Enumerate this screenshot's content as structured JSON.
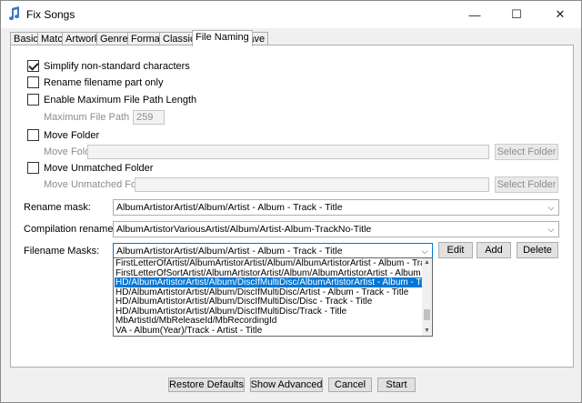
{
  "window": {
    "title": "Fix Songs",
    "minimize_glyph": "—",
    "maximize_glyph": "☐",
    "close_glyph": "✕"
  },
  "tabs": [
    {
      "label": "Basic"
    },
    {
      "label": "Match"
    },
    {
      "label": "Artwork"
    },
    {
      "label": "Genres"
    },
    {
      "label": "Format"
    },
    {
      "label": "Classical"
    },
    {
      "label": "File Naming",
      "active": true
    },
    {
      "label": "Save"
    }
  ],
  "options": {
    "simplify": {
      "label": "Simplify non-standard characters",
      "checked": true
    },
    "rename_part": {
      "label": "Rename filename part only",
      "checked": false
    },
    "max_path": {
      "label": "Enable Maximum File Path Length",
      "checked": false
    },
    "max_path_length_label": "Maximum File Path Length",
    "max_path_length_value": "259",
    "move_folder": {
      "label": "Move Folder",
      "checked": false
    },
    "move_folder_field_label": "Move Folder",
    "move_folder_value": "",
    "select_folder_1": "Select Folder",
    "move_unmatched": {
      "label": "Move Unmatched Folder",
      "checked": false
    },
    "move_unmatched_field_label": "Move Unmatched Folder",
    "move_unmatched_value": "",
    "select_folder_2": "Select Folder"
  },
  "masks": {
    "rename_label": "Rename mask:",
    "rename_value": "AlbumArtistorArtist/Album/Artist - Album - Track - Title",
    "compilation_label": "Compilation rename mask:",
    "compilation_value": "AlbumArtistorVariousArtist/Album/Artist-Album-TrackNo-Title",
    "filename_label": "Filename Masks:",
    "filename_value": "AlbumArtistorArtist/Album/Artist - Album - Track - Title",
    "edit": "Edit",
    "add": "Add",
    "delete": "Delete",
    "dropdown_items": [
      {
        "text": "FirstLetterOfArtist/AlbumArtistorArtist/Album/AlbumArtistorArtist - Album - Track - Title",
        "selected": false
      },
      {
        "text": "FirstLetterOfSortArtist/AlbumArtistorArtist/Album/AlbumArtistorArtist - Album - Track - Title",
        "selected": false
      },
      {
        "text": "HD/AlbumArtistorArtist/Album/DiscIfMultiDisc/AlbumArtistorArtist - Album - Track - Title",
        "selected": true
      },
      {
        "text": "HD/AlbumArtistorArtist/Album/DiscIfMultiDisc/Artist - Album - Track - Title",
        "selected": false
      },
      {
        "text": "HD/AlbumArtistorArtist/Album/DiscIfMultiDisc/Disc - Track - Title",
        "selected": false
      },
      {
        "text": "HD/AlbumArtistorArtist/Album/DiscIfMultiDisc/Track - Title",
        "selected": false
      },
      {
        "text": "MbArtistId/MbReleaseId/MbRecordingId",
        "selected": false
      },
      {
        "text": "VA - Album(Year)/Track - Artist - Title",
        "selected": false
      }
    ]
  },
  "footer": {
    "restore_defaults": "Restore Defaults",
    "show_advanced": "Show Advanced",
    "cancel": "Cancel",
    "start": "Start"
  },
  "colors": {
    "accent": "#0078d7",
    "window_bg": "#f0f0f0",
    "panel_bg": "#ffffff"
  }
}
